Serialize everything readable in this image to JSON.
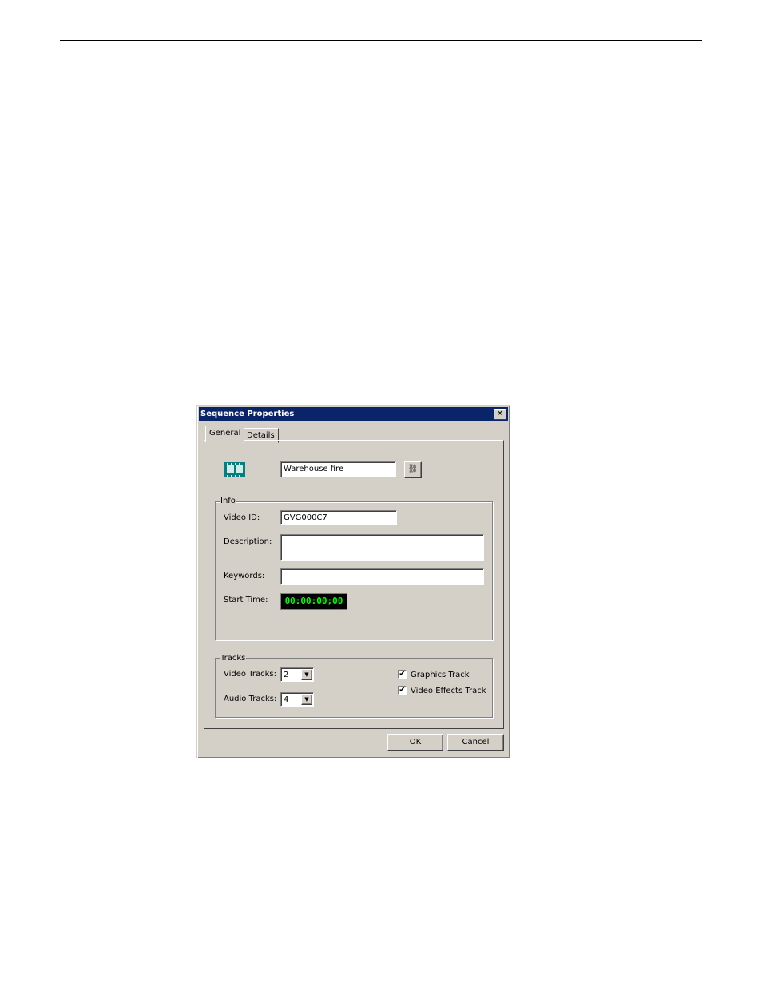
{
  "dialog": {
    "title": "Sequence Properties",
    "close_label": "✕",
    "tabs": [
      {
        "label": "General"
      },
      {
        "label": "Details"
      }
    ],
    "name_value": "Warehouse fire",
    "info": {
      "legend": "Info",
      "video_id_label": "Video ID:",
      "video_id_value": "GVG000C7",
      "description_label": "Description:",
      "description_value": "",
      "keywords_label": "Keywords:",
      "keywords_value": "",
      "start_time_label": "Start Time:",
      "start_time_value": "00:00:00;00",
      "timecode_color": "#00ff00"
    },
    "tracks": {
      "legend": "Tracks",
      "video_label": "Video Tracks:",
      "video_value": "2",
      "audio_label": "Audio Tracks:",
      "audio_value": "4",
      "graphics_label": "Graphics Track",
      "graphics_checked": true,
      "effects_label": "Video Effects Track",
      "effects_checked": true
    },
    "ok_label": "OK",
    "cancel_label": "Cancel"
  }
}
